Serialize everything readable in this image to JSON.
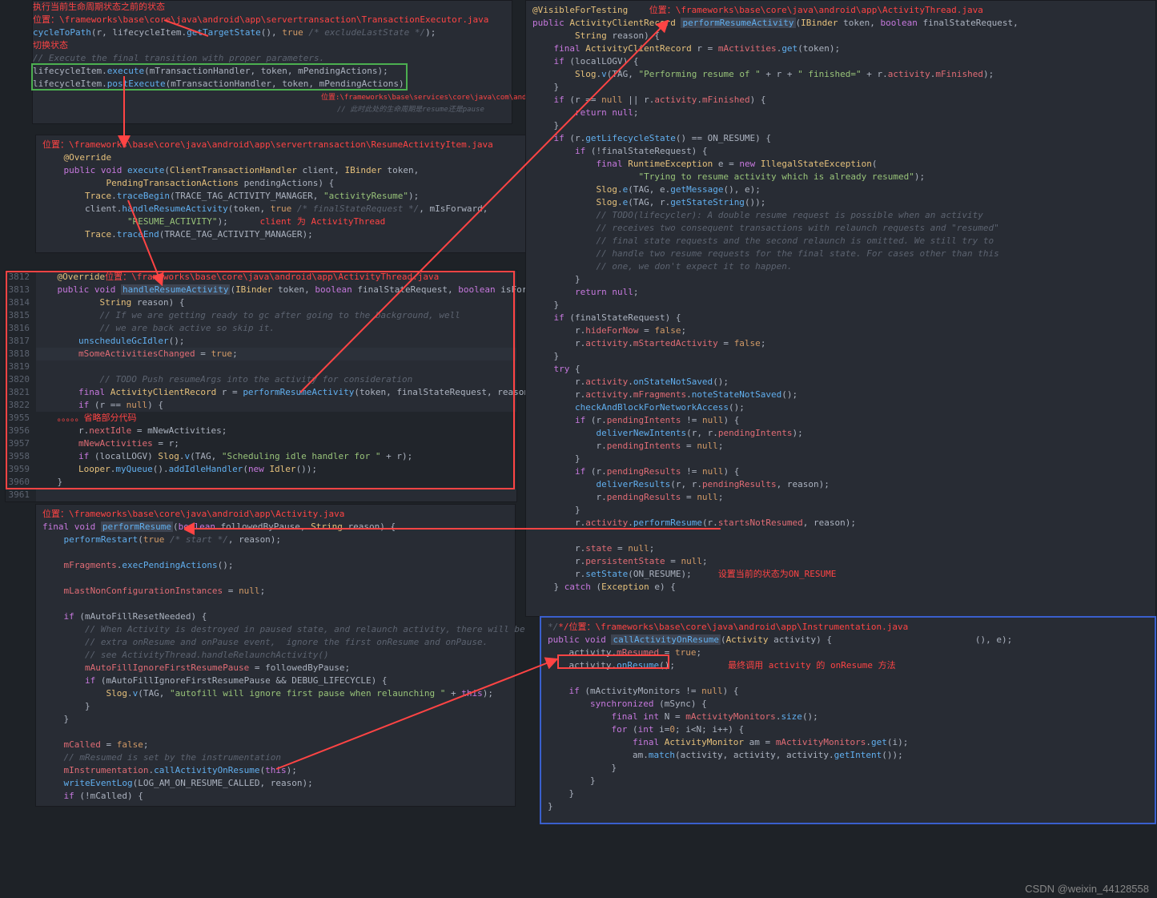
{
  "watermark": "CSDN @weixin_44128558",
  "panel1": {
    "loc": "位置：\\frameworks\\base\\core\\java\\android\\app\\servertransaction\\TransactionExecutor.java",
    "note_top": "执行当前生命周期状态之前的状态",
    "note_switch": "切换状态",
    "note_right": "位置:\\frameworks\\base\\services\\core\\java\\com\\android",
    "note_pause": "// 此时此处的生命周期是resume还是pause",
    "l1": "cycleToPath(r, lifecycleItem.getTargetState(), true /* excludeLastState */);",
    "l2": "// Execute the final transition with proper parameters.",
    "l3": "lifecycleItem.execute(mTransactionHandler, token, mPendingActions);",
    "l4": "lifecycleItem.postExecute(mTransactionHandler, token, mPendingActions);"
  },
  "panel2": {
    "loc": "位置：\\frameworks\\base\\core\\java\\android\\app\\servertransaction\\ResumeActivityItem.java",
    "l1": "@Override",
    "l2": "public void execute(ClientTransactionHandler client, IBinder token,",
    "l3": "        PendingTransactionActions pendingActions) {",
    "l4": "    Trace.traceBegin(TRACE_TAG_ACTIVITY_MANAGER, \"activityResume\");",
    "l5": "    client.handleResumeActivity(token, true /* finalStateRequest */, mIsForward,",
    "l6": "            \"RESUME_ACTIVITY\");",
    "note_client": "client 为 ActivityThread",
    "l7": "    Trace.traceEnd(TRACE_TAG_ACTIVITY_MANAGER);"
  },
  "panel3": {
    "loc": "位置：\\frameworks\\base\\core\\java\\android\\app\\ActivityThread.java",
    "ln": [
      "3812",
      "3813",
      "3814",
      "3815",
      "3816",
      "3817",
      "3818",
      "3819",
      "3820",
      "3821",
      "3822",
      "3955",
      "3956",
      "3957",
      "3958",
      "3959",
      "3960",
      "3961"
    ],
    "l1": "@Override",
    "l2": "public void handleResumeActivity(IBinder token, boolean finalStateRequest, boolean isForwar",
    "l3": "        String reason) {",
    "l4": "    // If we are getting ready to gc after going to the background, well",
    "l5": "    // we are back active so skip it.",
    "l6": "    unscheduleGcIdler();",
    "l7": "    mSomeActivitiesChanged = true;",
    "l8": "",
    "l9": "    // TODO Push resumeArgs into the activity for consideration",
    "l10": "    final ActivityClientRecord r = performResumeActivity(token, finalStateRequest, reason);",
    "l11": "    if (r == null) {",
    "note_omit": "。。。。。省略部分代码",
    "l12": "    r.nextIdle = mNewActivities;",
    "l13": "    mNewActivities = r;",
    "l14": "    if (localLOGV) Slog.v(TAG, \"Scheduling idle handler for \" + r);",
    "l15": "    Looper.myQueue().addIdleHandler(new Idler());",
    "l16": "}"
  },
  "panel4": {
    "loc": "位置：\\frameworks\\base\\core\\java\\android\\app\\Activity.java",
    "l1": "final void performResume(boolean followedByPause, String reason) {",
    "l2": "    performRestart(true /* start */, reason);",
    "l3": "",
    "l4": "    mFragments.execPendingActions();",
    "l5": "",
    "l6": "    mLastNonConfigurationInstances = null;",
    "l7": "",
    "l8": "    if (mAutoFillResetNeeded) {",
    "l9": "        // When Activity is destroyed in paused state, and relaunch activity, there will be",
    "l10": "        // extra onResume and onPause event,  ignore the first onResume and onPause.",
    "l11": "        // see ActivityThread.handleRelaunchActivity()",
    "l12": "        mAutoFillIgnoreFirstResumePause = followedByPause;",
    "l13": "        if (mAutoFillIgnoreFirstResumePause && DEBUG_LIFECYCLE) {",
    "l14": "            Slog.v(TAG, \"autofill will ignore first pause when relaunching \" + this);",
    "l15": "        }",
    "l16": "    }",
    "l17": "",
    "l18": "    mCalled = false;",
    "l19": "    // mResumed is set by the instrumentation",
    "l20": "    mInstrumentation.callActivityOnResume(this);",
    "l21": "    writeEventLog(LOG_AM_ON_RESUME_CALLED, reason);",
    "l22": "    if (!mCalled) {"
  },
  "panel5": {
    "loc": "位置：\\frameworks\\base\\core\\java\\android\\app\\ActivityThread.java",
    "l1": "@VisibleForTesting",
    "l2": "public ActivityClientRecord performResumeActivity(IBinder token, boolean finalStateRequest,",
    "l3": "        String reason) {",
    "l4": "    final ActivityClientRecord r = mActivities.get(token);",
    "l5": "    if (localLOGV) {",
    "l6": "        Slog.v(TAG, \"Performing resume of \" + r + \" finished=\" + r.activity.mFinished);",
    "l7": "    }",
    "l8": "    if (r == null || r.activity.mFinished) {",
    "l9": "        return null;",
    "l10": "    }",
    "l11": "    if (r.getLifecycleState() == ON_RESUME) {",
    "l12": "        if (!finalStateRequest) {",
    "l13": "            final RuntimeException e = new IllegalStateException(",
    "l14": "                    \"Trying to resume activity which is already resumed\");",
    "l15": "            Slog.e(TAG, e.getMessage(), e);",
    "l16": "            Slog.e(TAG, r.getStateString());",
    "l17": "            // TODO(lifecycler): A double resume request is possible when an activity",
    "l18": "            // receives two consequent transactions with relaunch requests and \"resumed\"",
    "l19": "            // final state requests and the second relaunch is omitted. We still try to",
    "l20": "            // handle two resume requests for the final state. For cases other than this",
    "l21": "            // one, we don't expect it to happen.",
    "l22": "        }",
    "l23": "        return null;",
    "l24": "    }",
    "l25": "    if (finalStateRequest) {",
    "l26": "        r.hideForNow = false;",
    "l27": "        r.activity.mStartedActivity = false;",
    "l28": "    }",
    "l29": "    try {",
    "l30": "        r.activity.onStateNotSaved();",
    "l31": "        r.activity.mFragments.noteStateNotSaved();",
    "l32": "        checkAndBlockForNetworkAccess();",
    "l33": "        if (r.pendingIntents != null) {",
    "l34": "            deliverNewIntents(r, r.pendingIntents);",
    "l35": "            r.pendingIntents = null;",
    "l36": "        }",
    "l37": "        if (r.pendingResults != null) {",
    "l38": "            deliverResults(r, r.pendingResults, reason);",
    "l39": "            r.pendingResults = null;",
    "l40": "        }",
    "l41": "        r.activity.performResume(r.startsNotResumed, reason);",
    "l42": "",
    "l43": "        r.state = null;",
    "l44": "        r.persistentState = null;",
    "l45": "        r.setState(ON_RESUME);",
    "note_state": "设置当前的状态为ON_RESUME",
    "l46": "    } catch (Exception e) {"
  },
  "panel6": {
    "loc": "*/位置：\\frameworks\\base\\core\\java\\android\\app\\Instrumentation.java",
    "l1": "public void callActivityOnResume(Activity activity) {",
    "l2": "    activity.mResumed = true;",
    "l3": "    activity.onResume();",
    "note_final": "最终调用 activity 的 onResume 方法",
    "note_right": "(), e);",
    "l4": "",
    "l5": "    if (mActivityMonitors != null) {",
    "l6": "        synchronized (mSync) {",
    "l7": "            final int N = mActivityMonitors.size();",
    "l8": "            for (int i=0; i<N; i++) {",
    "l9": "                final ActivityMonitor am = mActivityMonitors.get(i);",
    "l10": "                am.match(activity, activity, activity.getIntent());",
    "l11": "            }",
    "l12": "        }",
    "l13": "    }",
    "l14": "}"
  }
}
